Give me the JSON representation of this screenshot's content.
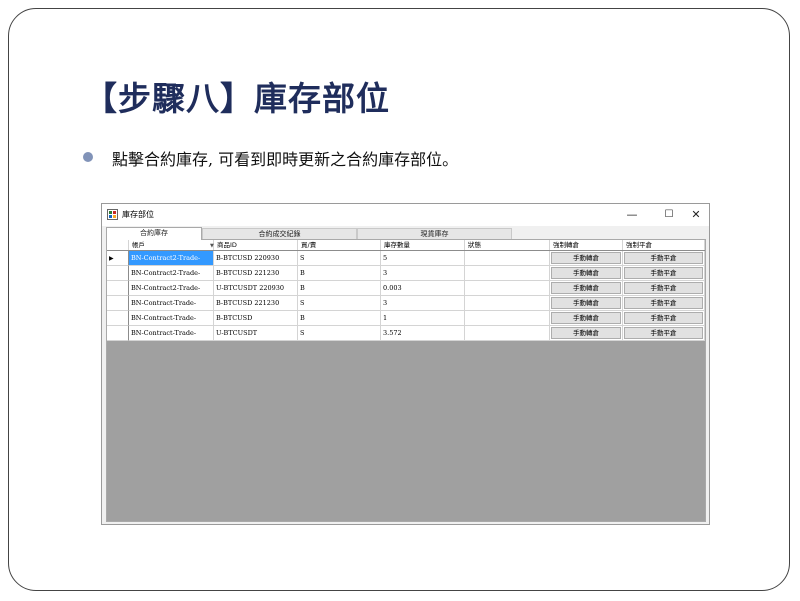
{
  "slide": {
    "title": "【步驟八】庫存部位",
    "bullet": "點擊合約庫存, 可看到即時更新之合約庫存部位。"
  },
  "window": {
    "title": "庫存部位",
    "controls": {
      "minimize": "—",
      "maximize": "☐",
      "close": "✕"
    },
    "tabs": [
      {
        "label": "合約庫存",
        "active": true
      },
      {
        "label": "合約成交紀錄",
        "active": false
      },
      {
        "label": "現貨庫存",
        "active": false
      }
    ]
  },
  "grid": {
    "columns": [
      "帳戶",
      "商品ID",
      "買/賣",
      "庫存數量",
      "狀態",
      "強制轉倉",
      "強制平倉"
    ],
    "rows": [
      {
        "account": "BN-Contract2-Trade-",
        "product": "B-BTCUSD 220930",
        "side": "S",
        "qty": "5",
        "status": "",
        "transfer": "手動轉倉",
        "close": "手動平倉",
        "current": true
      },
      {
        "account": "BN-Contract2-Trade-",
        "product": "B-BTCUSD 221230",
        "side": "B",
        "qty": "3",
        "status": "",
        "transfer": "手動轉倉",
        "close": "手動平倉"
      },
      {
        "account": "BN-Contract2-Trade-",
        "product": "U-BTCUSDT 220930",
        "side": "B",
        "qty": "0.003",
        "status": "",
        "transfer": "手動轉倉",
        "close": "手動平倉"
      },
      {
        "account": "BN-Contract-Trade-",
        "product": "B-BTCUSD 221230",
        "side": "S",
        "qty": "3",
        "status": "",
        "transfer": "手動轉倉",
        "close": "手動平倉"
      },
      {
        "account": "BN-Contract-Trade-",
        "product": "B-BTCUSD",
        "side": "B",
        "qty": "1",
        "status": "",
        "transfer": "手動轉倉",
        "close": "手動平倉"
      },
      {
        "account": "BN-Contract-Trade-",
        "product": "U-BTCUSDT",
        "side": "S",
        "qty": "3.572",
        "status": "",
        "transfer": "手動轉倉",
        "close": "手動平倉"
      }
    ]
  },
  "colors": {
    "title": "#1f2d5c",
    "bullet": "#8193b8",
    "selection": "#3399ff",
    "grid_background": "#a0a0a0"
  }
}
